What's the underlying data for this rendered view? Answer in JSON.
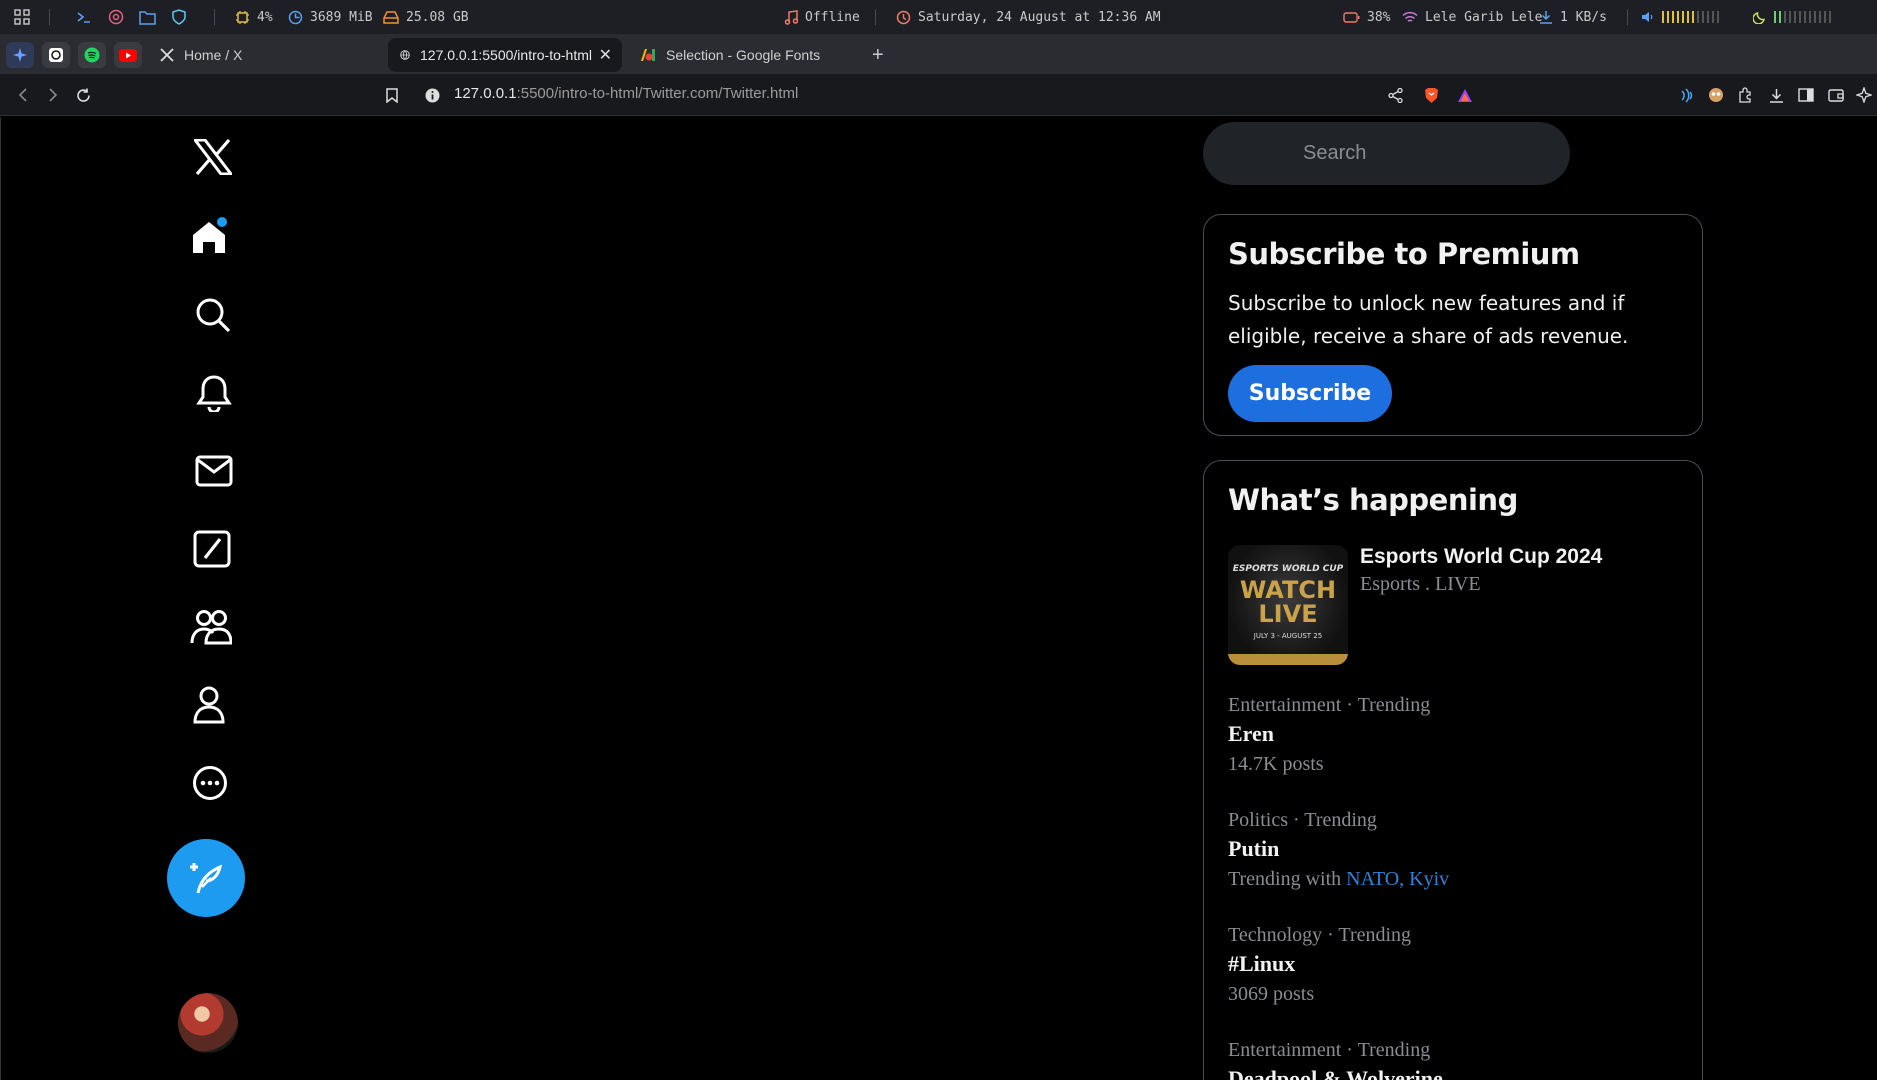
{
  "system_bar": {
    "cpu": "4%",
    "memory": "3689 MiB",
    "disk": "25.08 GB",
    "music_status": "Offline",
    "datetime": "Saturday, 24 August at 12:36 AM",
    "battery": "38%",
    "wifi": "Lele Garib Lele",
    "network_speed": "1 KB/s"
  },
  "browser": {
    "tabs": [
      {
        "label": "Home / X",
        "active": false
      },
      {
        "label": "127.0.0.1:5500/intro-to-html",
        "active": true
      },
      {
        "label": "Selection - Google Fonts",
        "active": false
      }
    ],
    "url_host": "127.0.0.1",
    "url_rest": ":5500/intro-to-html/Twitter.com/Twitter.html"
  },
  "sidebar_icons": [
    "x-logo-icon",
    "home-icon",
    "search-icon",
    "bell-icon",
    "mail-icon",
    "grok-icon",
    "communities-icon",
    "profile-icon",
    "more-icon"
  ],
  "search": {
    "placeholder": "Search"
  },
  "premium": {
    "title": "Subscribe to Premium",
    "body": "Subscribe to unlock new features and if eligible, receive a share of ads revenue.",
    "button": "Subscribe"
  },
  "happening": {
    "title": "What’s happening",
    "featured": {
      "title": "Esports World Cup 2024",
      "subtitle": "Esports . LIVE",
      "image_text_top": "ESPORTS WORLD CUP",
      "image_text_main": "WATCH LIVE",
      "image_text_dates": "JULY 3 - AUGUST 25"
    },
    "trends": [
      {
        "meta": "Entertainment · Trending",
        "name": "Eren",
        "sub": "14.7K posts"
      },
      {
        "meta": "Politics · Trending",
        "name": "Putin",
        "sub_prefix": "Trending with ",
        "sub_link": "NATO, Kyiv"
      },
      {
        "meta": "Technology · Trending",
        "name": "#Linux",
        "sub": "3069 posts"
      },
      {
        "meta": "Entertainment · Trending",
        "name": "Deadpool & Wolverine"
      }
    ]
  },
  "colors": {
    "accent": "#1d9bf0",
    "subscribe": "#1d6fe0",
    "link": "#2d83d6",
    "muted": "#8a8d91"
  }
}
